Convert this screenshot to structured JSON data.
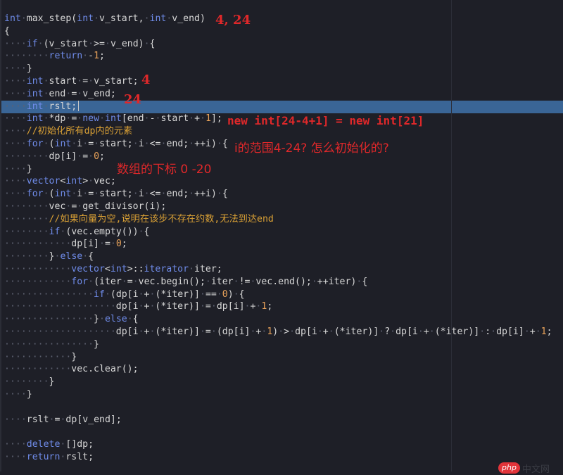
{
  "editor": {
    "highlighted_line": 8,
    "lines": [
      [
        [
          "tp",
          "int"
        ],
        [
          "ws",
          "·"
        ],
        [
          "plain",
          "max_step("
        ],
        [
          "tp",
          "int"
        ],
        [
          "ws",
          "·"
        ],
        [
          "plain",
          "v_start,"
        ],
        [
          "ws",
          "·"
        ],
        [
          "tp",
          "int"
        ],
        [
          "ws",
          "·"
        ],
        [
          "plain",
          "v_end)"
        ]
      ],
      [
        [
          "plain",
          "{"
        ]
      ],
      [
        [
          "ws",
          "····"
        ],
        [
          "kw",
          "if"
        ],
        [
          "ws",
          "·"
        ],
        [
          "plain",
          "(v_start"
        ],
        [
          "ws",
          "·"
        ],
        [
          "plain",
          ">="
        ],
        [
          "ws",
          "·"
        ],
        [
          "plain",
          "v_end)"
        ],
        [
          "ws",
          "·"
        ],
        [
          "plain",
          "{"
        ]
      ],
      [
        [
          "ws",
          "········"
        ],
        [
          "kw",
          "return"
        ],
        [
          "ws",
          "·"
        ],
        [
          "plain",
          "-"
        ],
        [
          "num",
          "1"
        ],
        [
          "plain",
          ";"
        ]
      ],
      [
        [
          "ws",
          "····"
        ],
        [
          "plain",
          "}"
        ]
      ],
      [
        [
          "ws",
          "····"
        ],
        [
          "tp",
          "int"
        ],
        [
          "ws",
          "·"
        ],
        [
          "plain",
          "start"
        ],
        [
          "ws",
          "·"
        ],
        [
          "plain",
          "="
        ],
        [
          "ws",
          "·"
        ],
        [
          "plain",
          "v_start;"
        ]
      ],
      [
        [
          "ws",
          "····"
        ],
        [
          "tp",
          "int"
        ],
        [
          "ws",
          "·"
        ],
        [
          "plain",
          "end"
        ],
        [
          "ws",
          "·"
        ],
        [
          "plain",
          "="
        ],
        [
          "ws",
          "·"
        ],
        [
          "plain",
          "v_end;"
        ]
      ],
      [
        [
          "ws",
          "····"
        ],
        [
          "tp",
          "int"
        ],
        [
          "ws",
          "·"
        ],
        [
          "plain",
          "rslt;"
        ]
      ],
      [
        [
          "ws",
          "····"
        ],
        [
          "tp",
          "int"
        ],
        [
          "ws",
          "·"
        ],
        [
          "plain",
          "*dp"
        ],
        [
          "ws",
          "·"
        ],
        [
          "plain",
          "="
        ],
        [
          "ws",
          "·"
        ],
        [
          "kw",
          "new"
        ],
        [
          "ws",
          "·"
        ],
        [
          "tp",
          "int"
        ],
        [
          "plain",
          "[end"
        ],
        [
          "ws",
          "·"
        ],
        [
          "plain",
          "-"
        ],
        [
          "ws",
          "·"
        ],
        [
          "plain",
          "start"
        ],
        [
          "ws",
          "·"
        ],
        [
          "plain",
          "+"
        ],
        [
          "ws",
          "·"
        ],
        [
          "num",
          "1"
        ],
        [
          "plain",
          "];"
        ]
      ],
      [
        [
          "ws",
          "····"
        ],
        [
          "cmt",
          "//初始化所有dp内的元素"
        ]
      ],
      [
        [
          "ws",
          "····"
        ],
        [
          "kw",
          "for"
        ],
        [
          "ws",
          "·"
        ],
        [
          "plain",
          "("
        ],
        [
          "tp",
          "int"
        ],
        [
          "ws",
          "·"
        ],
        [
          "plain",
          "i"
        ],
        [
          "ws",
          "·"
        ],
        [
          "plain",
          "="
        ],
        [
          "ws",
          "·"
        ],
        [
          "plain",
          "start;"
        ],
        [
          "ws",
          "·"
        ],
        [
          "plain",
          "i"
        ],
        [
          "ws",
          "·"
        ],
        [
          "plain",
          "<="
        ],
        [
          "ws",
          "·"
        ],
        [
          "plain",
          "end;"
        ],
        [
          "ws",
          "·"
        ],
        [
          "plain",
          "++i)"
        ],
        [
          "ws",
          "·"
        ],
        [
          "plain",
          "{"
        ]
      ],
      [
        [
          "ws",
          "········"
        ],
        [
          "plain",
          "dp[i]"
        ],
        [
          "ws",
          "·"
        ],
        [
          "plain",
          "="
        ],
        [
          "ws",
          "·"
        ],
        [
          "num",
          "0"
        ],
        [
          "plain",
          ";"
        ]
      ],
      [
        [
          "ws",
          "····"
        ],
        [
          "plain",
          "}"
        ]
      ],
      [
        [
          "ws",
          "····"
        ],
        [
          "tp",
          "vector"
        ],
        [
          "plain",
          "<"
        ],
        [
          "tp",
          "int"
        ],
        [
          "plain",
          ">"
        ],
        [
          "ws",
          "·"
        ],
        [
          "plain",
          "vec;"
        ]
      ],
      [
        [
          "ws",
          "····"
        ],
        [
          "kw",
          "for"
        ],
        [
          "ws",
          "·"
        ],
        [
          "plain",
          "("
        ],
        [
          "tp",
          "int"
        ],
        [
          "ws",
          "·"
        ],
        [
          "plain",
          "i"
        ],
        [
          "ws",
          "·"
        ],
        [
          "plain",
          "="
        ],
        [
          "ws",
          "·"
        ],
        [
          "plain",
          "start;"
        ],
        [
          "ws",
          "·"
        ],
        [
          "plain",
          "i"
        ],
        [
          "ws",
          "·"
        ],
        [
          "plain",
          "<="
        ],
        [
          "ws",
          "·"
        ],
        [
          "plain",
          "end;"
        ],
        [
          "ws",
          "·"
        ],
        [
          "plain",
          "++i)"
        ],
        [
          "ws",
          "·"
        ],
        [
          "plain",
          "{"
        ]
      ],
      [
        [
          "ws",
          "········"
        ],
        [
          "plain",
          "vec"
        ],
        [
          "ws",
          "·"
        ],
        [
          "plain",
          "="
        ],
        [
          "ws",
          "·"
        ],
        [
          "plain",
          "get_divisor(i);"
        ]
      ],
      [
        [
          "ws",
          "········"
        ],
        [
          "cmt",
          "//如果向量为空,说明在该步不存在约数,无法到达end"
        ]
      ],
      [
        [
          "ws",
          "········"
        ],
        [
          "kw",
          "if"
        ],
        [
          "ws",
          "·"
        ],
        [
          "plain",
          "(vec.empty())"
        ],
        [
          "ws",
          "·"
        ],
        [
          "plain",
          "{"
        ]
      ],
      [
        [
          "ws",
          "············"
        ],
        [
          "plain",
          "dp[i]"
        ],
        [
          "ws",
          "·"
        ],
        [
          "plain",
          "="
        ],
        [
          "ws",
          "·"
        ],
        [
          "num",
          "0"
        ],
        [
          "plain",
          ";"
        ]
      ],
      [
        [
          "ws",
          "········"
        ],
        [
          "plain",
          "}"
        ],
        [
          "ws",
          "·"
        ],
        [
          "kw",
          "else"
        ],
        [
          "ws",
          "·"
        ],
        [
          "plain",
          "{"
        ]
      ],
      [
        [
          "ws",
          "············"
        ],
        [
          "tp",
          "vector"
        ],
        [
          "plain",
          "<"
        ],
        [
          "tp",
          "int"
        ],
        [
          "plain",
          ">::"
        ],
        [
          "tp",
          "iterator"
        ],
        [
          "ws",
          "·"
        ],
        [
          "plain",
          "iter;"
        ]
      ],
      [
        [
          "ws",
          "············"
        ],
        [
          "kw",
          "for"
        ],
        [
          "ws",
          "·"
        ],
        [
          "plain",
          "(iter"
        ],
        [
          "ws",
          "·"
        ],
        [
          "plain",
          "="
        ],
        [
          "ws",
          "·"
        ],
        [
          "plain",
          "vec.begin();"
        ],
        [
          "ws",
          "·"
        ],
        [
          "plain",
          "iter"
        ],
        [
          "ws",
          "·"
        ],
        [
          "plain",
          "!="
        ],
        [
          "ws",
          "·"
        ],
        [
          "plain",
          "vec.end();"
        ],
        [
          "ws",
          "·"
        ],
        [
          "plain",
          "++iter)"
        ],
        [
          "ws",
          "·"
        ],
        [
          "plain",
          "{"
        ]
      ],
      [
        [
          "ws",
          "················"
        ],
        [
          "kw",
          "if"
        ],
        [
          "ws",
          "·"
        ],
        [
          "plain",
          "(dp[i"
        ],
        [
          "ws",
          "·"
        ],
        [
          "plain",
          "+"
        ],
        [
          "ws",
          "·"
        ],
        [
          "plain",
          "(*iter)]"
        ],
        [
          "ws",
          "·"
        ],
        [
          "plain",
          "=="
        ],
        [
          "ws",
          "·"
        ],
        [
          "num",
          "0"
        ],
        [
          "plain",
          ")"
        ],
        [
          "ws",
          "·"
        ],
        [
          "plain",
          "{"
        ]
      ],
      [
        [
          "ws",
          "····················"
        ],
        [
          "plain",
          "dp[i"
        ],
        [
          "ws",
          "·"
        ],
        [
          "plain",
          "+"
        ],
        [
          "ws",
          "·"
        ],
        [
          "plain",
          "(*iter)]"
        ],
        [
          "ws",
          "·"
        ],
        [
          "plain",
          "="
        ],
        [
          "ws",
          "·"
        ],
        [
          "plain",
          "dp[i]"
        ],
        [
          "ws",
          "·"
        ],
        [
          "plain",
          "+"
        ],
        [
          "ws",
          "·"
        ],
        [
          "num",
          "1"
        ],
        [
          "plain",
          ";"
        ]
      ],
      [
        [
          "ws",
          "················"
        ],
        [
          "plain",
          "}"
        ],
        [
          "ws",
          "·"
        ],
        [
          "kw",
          "else"
        ],
        [
          "ws",
          "·"
        ],
        [
          "plain",
          "{"
        ]
      ],
      [
        [
          "ws",
          "····················"
        ],
        [
          "plain",
          "dp[i"
        ],
        [
          "ws",
          "·"
        ],
        [
          "plain",
          "+"
        ],
        [
          "ws",
          "·"
        ],
        [
          "plain",
          "(*iter)]"
        ],
        [
          "ws",
          "·"
        ],
        [
          "plain",
          "="
        ],
        [
          "ws",
          "·"
        ],
        [
          "plain",
          "(dp[i]"
        ],
        [
          "ws",
          "·"
        ],
        [
          "plain",
          "+"
        ],
        [
          "ws",
          "·"
        ],
        [
          "num",
          "1"
        ],
        [
          "plain",
          ")"
        ],
        [
          "ws",
          "·"
        ],
        [
          "plain",
          ">"
        ],
        [
          "ws",
          "·"
        ],
        [
          "plain",
          "dp[i"
        ],
        [
          "ws",
          "·"
        ],
        [
          "plain",
          "+"
        ],
        [
          "ws",
          "·"
        ],
        [
          "plain",
          "(*iter)]"
        ],
        [
          "ws",
          "·"
        ],
        [
          "plain",
          "?"
        ],
        [
          "ws",
          "·"
        ],
        [
          "plain",
          "dp[i"
        ],
        [
          "ws",
          "·"
        ],
        [
          "plain",
          "+"
        ],
        [
          "ws",
          "·"
        ],
        [
          "plain",
          "(*iter)]"
        ],
        [
          "ws",
          "·"
        ],
        [
          "plain",
          ":"
        ],
        [
          "ws",
          "·"
        ],
        [
          "plain",
          "dp[i]"
        ],
        [
          "ws",
          "·"
        ],
        [
          "plain",
          "+"
        ],
        [
          "ws",
          "·"
        ],
        [
          "num",
          "1"
        ],
        [
          "plain",
          ";"
        ]
      ],
      [
        [
          "ws",
          "················"
        ],
        [
          "plain",
          "}"
        ]
      ],
      [
        [
          "ws",
          "············"
        ],
        [
          "plain",
          "}"
        ]
      ],
      [
        [
          "ws",
          "············"
        ],
        [
          "plain",
          "vec.clear();"
        ]
      ],
      [
        [
          "ws",
          "········"
        ],
        [
          "plain",
          "}"
        ]
      ],
      [
        [
          "ws",
          "····"
        ],
        [
          "plain",
          "}"
        ]
      ],
      [],
      [
        [
          "ws",
          "····"
        ],
        [
          "plain",
          "rslt"
        ],
        [
          "ws",
          "·"
        ],
        [
          "plain",
          "="
        ],
        [
          "ws",
          "·"
        ],
        [
          "plain",
          "dp[v_end];"
        ]
      ],
      [],
      [
        [
          "ws",
          "····"
        ],
        [
          "kw",
          "delete"
        ],
        [
          "ws",
          "·"
        ],
        [
          "plain",
          "[]dp;"
        ]
      ],
      [
        [
          "ws",
          "····"
        ],
        [
          "kw",
          "return"
        ],
        [
          "ws",
          "·"
        ],
        [
          "plain",
          "rslt;"
        ]
      ]
    ]
  },
  "annotations": {
    "params": "4, 24",
    "start_value": "4",
    "end_value": "24",
    "array_size": "new int[24-4+1] = new int[21]",
    "range_question": "i的范围4-24? 怎么初始化的?",
    "index_note": "数组的下标 0 -20"
  },
  "watermark": {
    "badge": "php",
    "text": "中文网"
  },
  "colors": {
    "background": "#1e1f27",
    "highlight": "#3a6596",
    "keyword": "#6f8be8",
    "comment": "#d9a035",
    "number": "#e8a25a",
    "annotation": "#e0282a"
  }
}
